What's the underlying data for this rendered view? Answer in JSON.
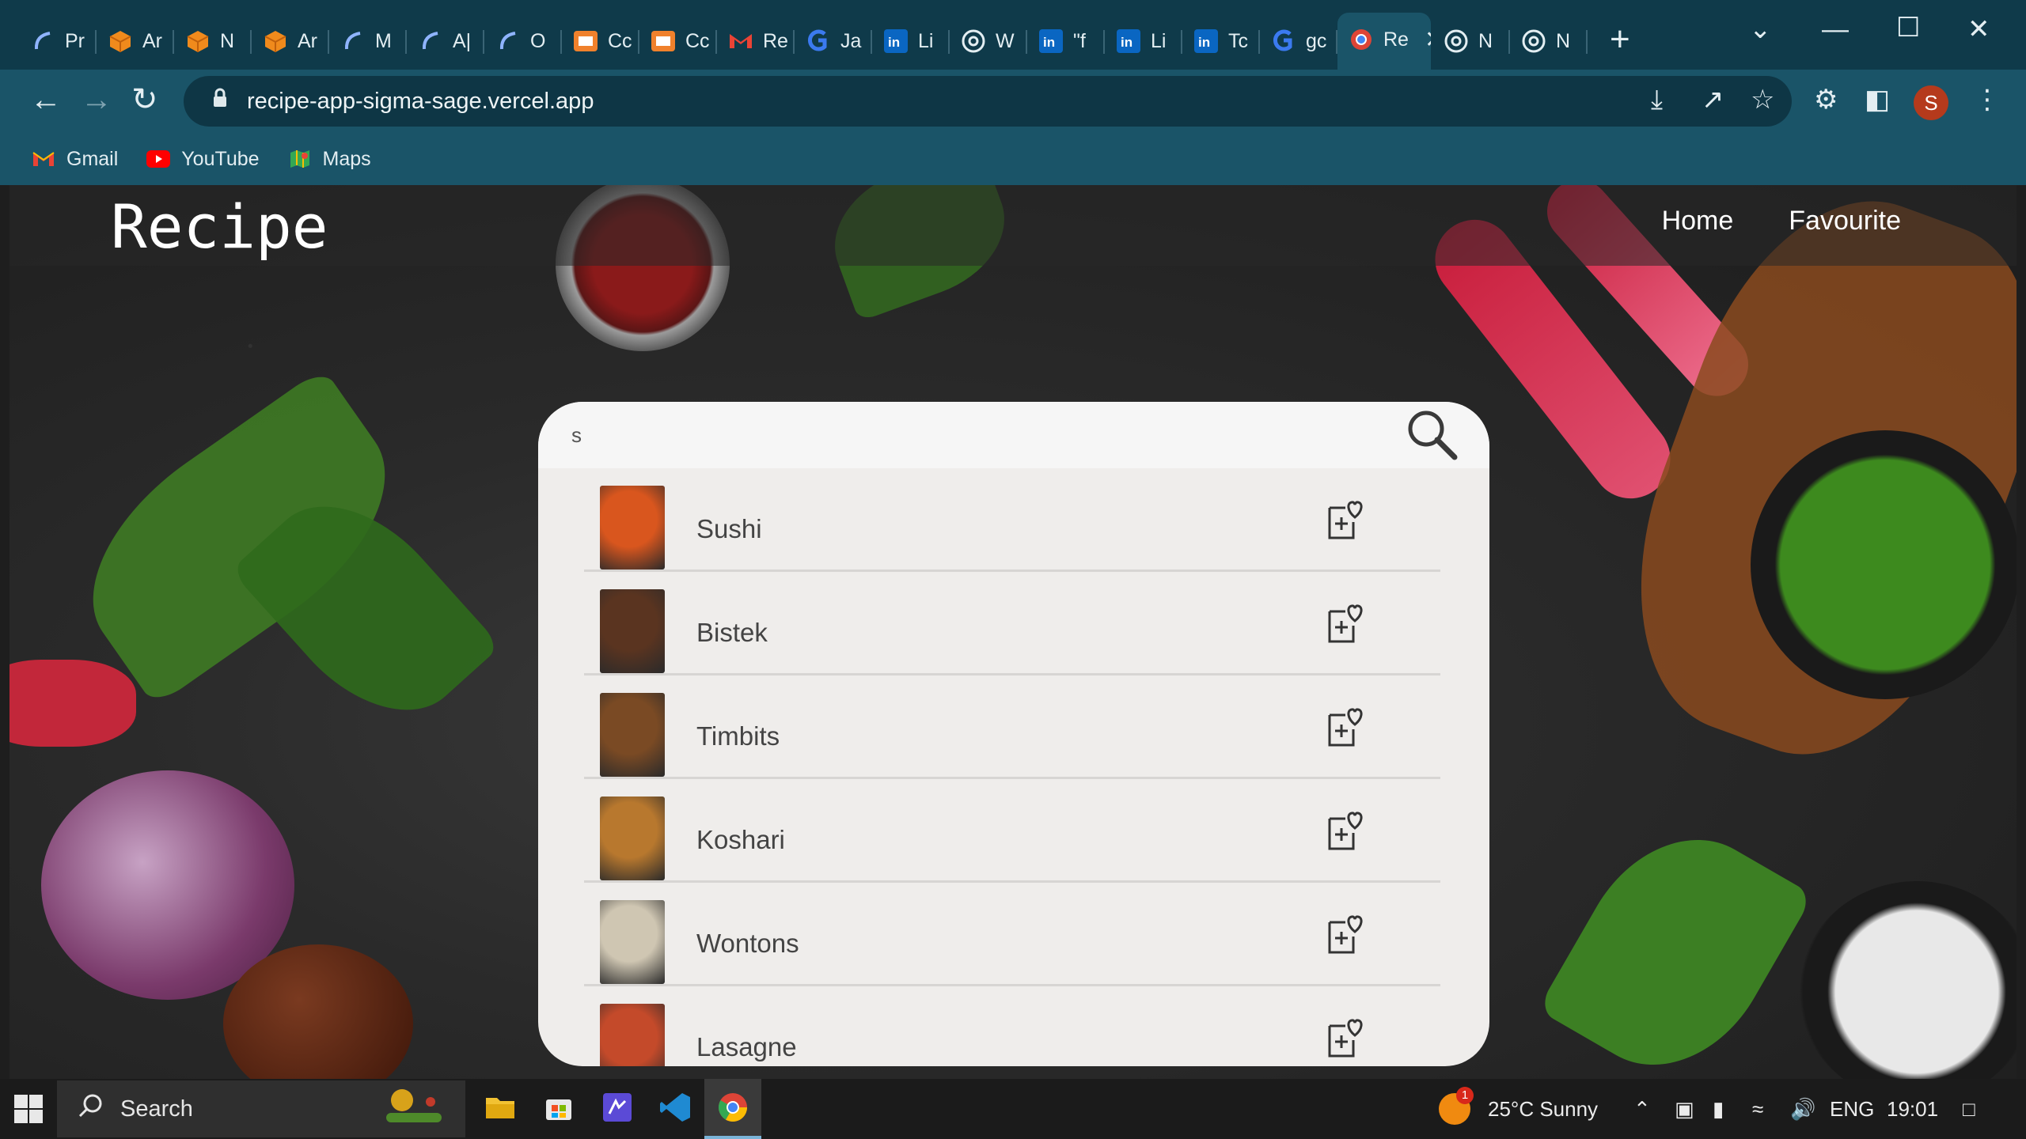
{
  "browser": {
    "tabs": [
      {
        "label": "Pr",
        "icon": "copilot-icon"
      },
      {
        "label": "Ar",
        "icon": "cube-icon"
      },
      {
        "label": "N",
        "icon": "cube-icon"
      },
      {
        "label": "Ar",
        "icon": "cube-icon"
      },
      {
        "label": "M",
        "icon": "copilot-icon"
      },
      {
        "label": "A|",
        "icon": "copilot-icon"
      },
      {
        "label": "O",
        "icon": "copilot-icon"
      },
      {
        "label": "Cc",
        "icon": "codepen-icon"
      },
      {
        "label": "Cc",
        "icon": "codepen-icon"
      },
      {
        "label": "Re",
        "icon": "gmail-icon"
      },
      {
        "label": "Ja",
        "icon": "g-icon"
      },
      {
        "label": "Li",
        "icon": "linkedin-icon"
      },
      {
        "label": "W",
        "icon": "openai-icon"
      },
      {
        "label": "\"f",
        "icon": "linkedin-icon"
      },
      {
        "label": "Li",
        "icon": "linkedin-icon"
      },
      {
        "label": "Tc",
        "icon": "linkedin-icon"
      },
      {
        "label": "gc",
        "icon": "g-icon"
      },
      {
        "label": "Re",
        "icon": "chrome-icon",
        "active": true
      },
      {
        "label": "N",
        "icon": "openai-icon"
      },
      {
        "label": "N",
        "icon": "openai-icon"
      }
    ],
    "address": "recipe-app-sigma-sage.vercel.app",
    "profile_initial": "S",
    "bookmarks": [
      {
        "label": "Gmail",
        "icon": "gmail-icon"
      },
      {
        "label": "YouTube",
        "icon": "youtube-icon"
      },
      {
        "label": "Maps",
        "icon": "maps-icon"
      }
    ]
  },
  "app": {
    "brand": "Recipe",
    "nav": {
      "home": "Home",
      "favourite": "Favourite"
    },
    "search": {
      "value": "s"
    },
    "results": [
      {
        "title": "Sushi",
        "thumb_color": "#d9561e"
      },
      {
        "title": "Bistek",
        "thumb_color": "#5a3420"
      },
      {
        "title": "Timbits",
        "thumb_color": "#7a4a24"
      },
      {
        "title": "Koshari",
        "thumb_color": "#b8782e"
      },
      {
        "title": "Wontons",
        "thumb_color": "#cfc6b2"
      },
      {
        "title": "Lasagne",
        "thumb_color": "#c44a2a"
      }
    ]
  },
  "taskbar": {
    "search_label": "Search",
    "weather": "25°C  Sunny",
    "language": "ENG",
    "time": "19:01",
    "notification_count": "1"
  },
  "colors": {
    "tabstrip": "#0f3a4a",
    "toolbar": "#1a5468",
    "card": "#efedeb"
  }
}
